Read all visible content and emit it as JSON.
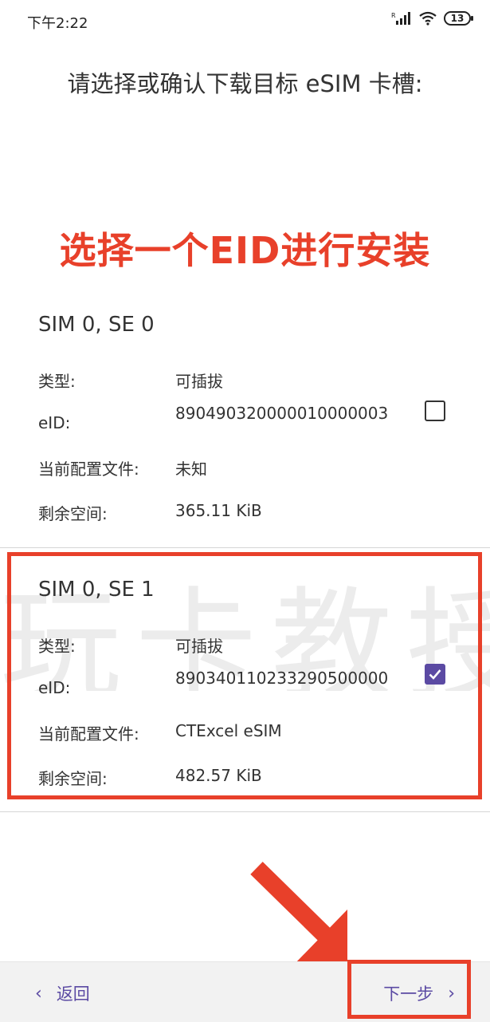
{
  "status_bar": {
    "time": "下午2:22",
    "battery": "13",
    "signal_icon": "signal-icon",
    "wifi_icon": "wifi-icon"
  },
  "title": "请选择或确认下载目标 eSIM 卡槽:",
  "annotation": "选择一个EID进行安装",
  "watermark": "玩卡教授",
  "labels": {
    "type": "类型:",
    "eid": "eID:",
    "profile": "当前配置文件:",
    "space": "剩余空间:"
  },
  "sims": [
    {
      "name": "SIM 0, SE 0",
      "type": "可插拔",
      "eid": "8904903200000100000​03",
      "profile": "未知",
      "space": "365.11 KiB",
      "checked": false
    },
    {
      "name": "SIM 0, SE 1",
      "type": "可插拔",
      "eid": "89034011023329050000​0",
      "profile": "CTExcel eSIM",
      "space": "482.57 KiB",
      "checked": true
    }
  ],
  "nav": {
    "back_label": "返回",
    "next_label": "下一步"
  },
  "colors": {
    "accent": "#5b4aa3",
    "annotation_red": "#e8402a"
  }
}
